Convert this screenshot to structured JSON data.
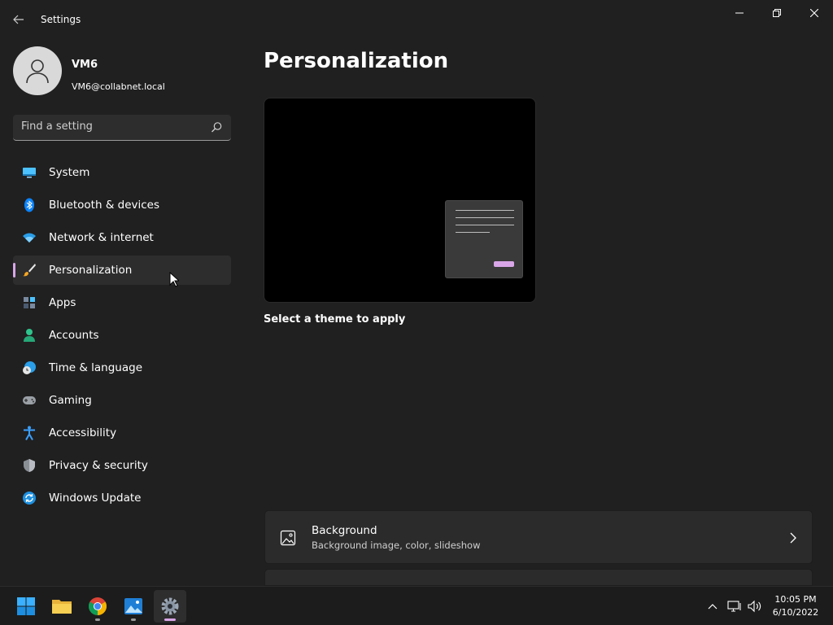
{
  "window": {
    "title": "Settings"
  },
  "profile": {
    "name": "VM6",
    "email": "VM6@collabnet.local"
  },
  "search": {
    "placeholder": "Find a setting"
  },
  "nav": [
    {
      "label": "System",
      "icon": "monitor-icon"
    },
    {
      "label": "Bluetooth & devices",
      "icon": "bluetooth-icon"
    },
    {
      "label": "Network & internet",
      "icon": "wifi-icon"
    },
    {
      "label": "Personalization",
      "icon": "paintbrush-icon",
      "selected": true
    },
    {
      "label": "Apps",
      "icon": "apps-icon"
    },
    {
      "label": "Accounts",
      "icon": "person-icon"
    },
    {
      "label": "Time & language",
      "icon": "clock-globe-icon"
    },
    {
      "label": "Gaming",
      "icon": "gamepad-icon"
    },
    {
      "label": "Accessibility",
      "icon": "accessibility-icon"
    },
    {
      "label": "Privacy & security",
      "icon": "shield-icon"
    },
    {
      "label": "Windows Update",
      "icon": "update-icon"
    }
  ],
  "main": {
    "title": "Personalization",
    "theme_hint": "Select a theme to apply",
    "cards": [
      {
        "title": "Background",
        "subtitle": "Background image, color, slideshow",
        "icon": "image-icon"
      }
    ]
  },
  "taskbar": {
    "apps": [
      "start-icon",
      "file-explorer-icon",
      "chrome-icon",
      "photos-icon",
      "settings-icon"
    ],
    "time": "10:05 PM",
    "date": "6/10/2022"
  },
  "colors": {
    "accent": "#d9a6e8",
    "background": "#202020",
    "card": "#2b2b2b"
  }
}
